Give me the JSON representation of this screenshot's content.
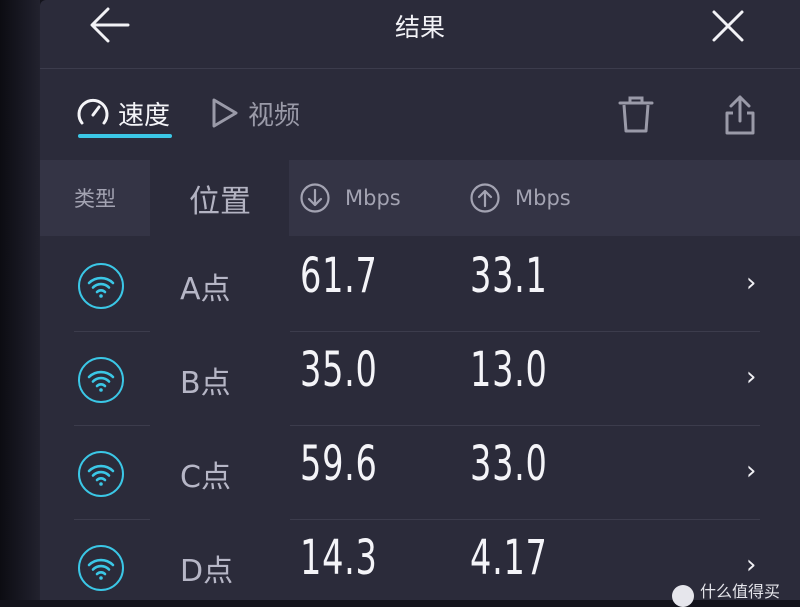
{
  "header": {
    "title": "结果"
  },
  "tabs": [
    {
      "label": "速度",
      "active": true
    },
    {
      "label": "视频",
      "active": false
    }
  ],
  "table": {
    "col_type": "类型",
    "col_location": "位置",
    "col_download_unit": "Mbps",
    "col_upload_unit": "Mbps",
    "rows": [
      {
        "location": "A点",
        "download": "61.7",
        "upload": "33.1"
      },
      {
        "location": "B点",
        "download": "35.0",
        "upload": "13.0"
      },
      {
        "location": "C点",
        "download": "59.6",
        "upload": "33.0"
      },
      {
        "location": "D点",
        "download": "14.3",
        "upload": "4.17"
      }
    ]
  },
  "watermark": {
    "text": "什么值得买"
  },
  "colors": {
    "accent": "#3bc7e6",
    "background": "#2b2b3a",
    "text": "#f4f4f8",
    "muted": "#a3a3b2"
  },
  "icons": [
    "back-arrow-icon",
    "close-icon",
    "speedometer-icon",
    "play-icon",
    "trash-icon",
    "share-icon",
    "download-arrow-icon",
    "upload-arrow-icon",
    "wifi-icon",
    "chevron-right-icon"
  ]
}
